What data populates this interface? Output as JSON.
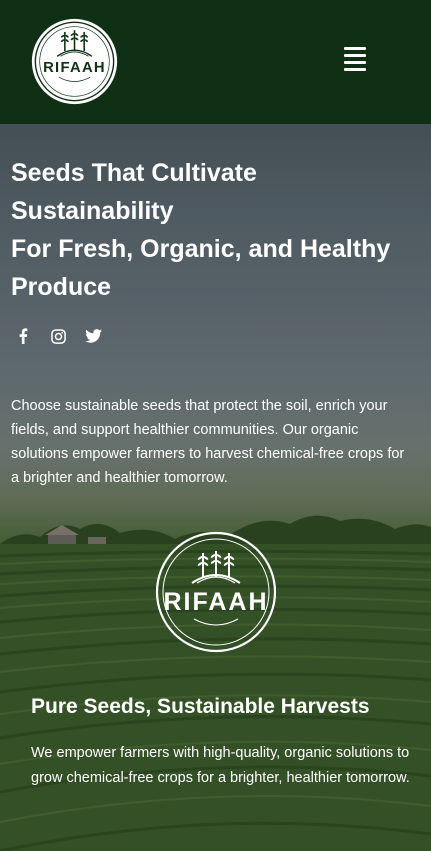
{
  "header": {
    "logo_text": "RIFAAH",
    "menu_icon": "hamburger-menu-icon"
  },
  "hero": {
    "title_lines": [
      "Seeds That Cultivate",
      "Sustainability",
      "For Fresh, Organic, and Healthy",
      "Produce"
    ],
    "social_icons": [
      "facebook-icon",
      "instagram-icon",
      "twitter-icon"
    ],
    "description": "Choose sustainable seeds that protect the soil, enrich your fields, and support healthier communities. Our organic solutions empower farmers to harvest chemical-free crops for a brighter and healthier tomorrow.",
    "logo_text": "RIFAAH"
  },
  "section": {
    "title": "Pure Seeds, Sustainable Harvests",
    "text": "We empower farmers with high-quality, organic solutions to grow chemical-free crops for a brighter, healthier tomorrow."
  },
  "colors": {
    "header_bg": "#0f3015",
    "text": "#ffffff"
  }
}
